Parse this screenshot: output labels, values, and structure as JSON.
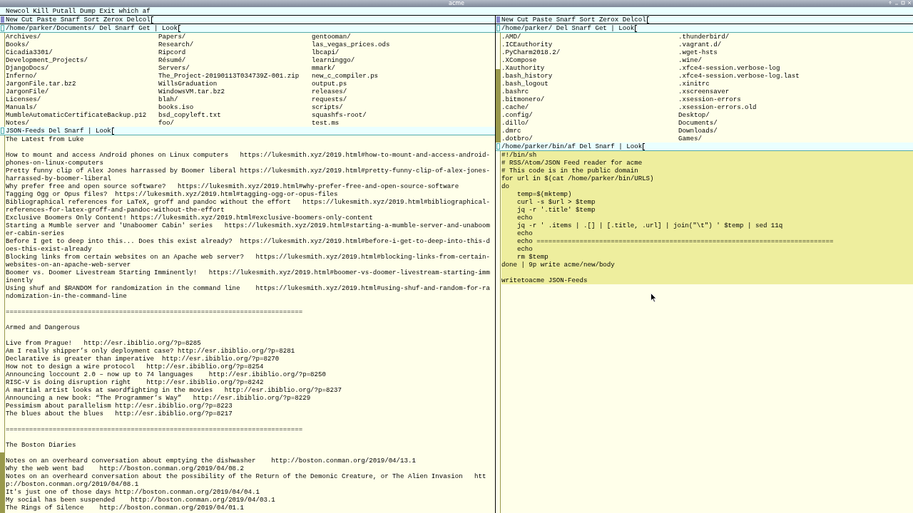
{
  "window": {
    "title": "acme"
  },
  "row_tag": "Newcol Kill Putall Dump Exit which af",
  "columns": [
    {
      "tag": "New Cut Paste Snarf Sort Zerox Delcol",
      "windows": [
        {
          "kind": "listing",
          "tag": "/home/parker/Documents/ Del Snarf Get | Look",
          "entries": [
            [
              "Archives/",
              "Books/",
              "Cicadia3301/",
              "Development_Projects/",
              "DjangoDocs/",
              "Inferno/",
              "JargonFile.tar.bz2",
              "JargonFile/",
              "Licenses/",
              "Manuals/",
              "MumbleAutomaticCertificateBackup.p12",
              "Notes/"
            ],
            [
              "Papers/",
              "Research/",
              "Ripcord",
              "Résumé/",
              "Servers/",
              "The_Project-20190113T034739Z-001.zip",
              "WillsGraduation",
              "WindowsVM.tar.bz2",
              "blah/",
              "books.iso",
              "bsd_copyleft.txt",
              "foo/"
            ],
            [
              "gentooman/",
              "las_vegas_prices.ods",
              "lbcapi/",
              "learninggo/",
              "mmark/",
              "new_c_compiler.ps",
              "output.ps",
              "releases/",
              "requests/",
              "scripts/",
              "squashfs-root/",
              "test.ms"
            ]
          ]
        },
        {
          "kind": "text",
          "tag": "JSON-Feeds Del Snarf | Look",
          "selected": false,
          "blocks": [
            [
              "The Latest from Luke"
            ],
            [
              "How to mount and access Android phones on Linux computers   https://lukesmith.xyz/2019.html#how-to-mount-and-access-android-phones-on-linux-computers",
              "Pretty funny clip of Alex Jones harrassed by Boomer liberal https://lukesmith.xyz/2019.html#pretty-funny-clip-of-alex-jones-harrassed-by-boomer-liberal",
              "Why prefer free and open source software?   https://lukesmith.xyz/2019.html#why-prefer-free-and-open-source-software",
              "Tagging Ogg or Opus files?  https://lukesmith.xyz/2019.html#tagging-ogg-or-opus-files",
              "Bibliographical references for LaTeX, groff and pandoc without the effort   https://lukesmith.xyz/2019.html#bibliographical-references-for-latex-groff-and-pandoc-without-the-effort",
              "Exclusive Boomers Only Content! https://lukesmith.xyz/2019.html#exclusive-boomers-only-content",
              "Starting a Mumble server and 'Unaboomer Cabin' series   https://lukesmith.xyz/2019.html#starting-a-mumble-server-and-unaboomer-cabin-series",
              "Before I get to deep into this... Does this exist already?  https://lukesmith.xyz/2019.html#before-i-get-to-deep-into-this-does-this-exist-already",
              "Blocking links from certain websites on an Apache web server?   https://lukesmith.xyz/2019.html#blocking-links-from-certain-websites-on-an-apache-web-server",
              "Boomer vs. Doomer Livestream Starting Imminently!   https://lukesmith.xyz/2019.html#boomer-vs-doomer-livestream-starting-imminently",
              "Using shuf and $RANDOM for randomization in the command line    https://lukesmith.xyz/2019.html#using-shuf-and-random-for-randomization-in-the-command-line"
            ],
            [
              "============================================================================"
            ],
            [
              "Armed and Dangerous"
            ],
            [
              "Live from Prague!   http://esr.ibiblio.org/?p=8285",
              "Am I really shipper’s only deployment case? http://esr.ibiblio.org/?p=8281",
              "Declarative is greater than imperative  http://esr.ibiblio.org/?p=8270",
              "How not to design a wire protocol   http://esr.ibiblio.org/?p=8254",
              "Announcing loccount 2.0 – now up to 74 languages    http://esr.ibiblio.org/?p=8250",
              "RISC-V is doing disruption right    http://esr.ibiblio.org/?p=8242",
              "A martial artist looks at swordfighting in the movies   http://esr.ibiblio.org/?p=8237",
              "Announcing a new book: “The Programmer’s Way”   http://esr.ibiblio.org/?p=8229",
              "Pessimism about parallelism http://esr.ibiblio.org/?p=8223",
              "The blues about the blues   http://esr.ibiblio.org/?p=8217"
            ],
            [
              "============================================================================"
            ],
            [
              "The Boston Diaries"
            ],
            [
              "Notes on an overheard conversation about emptying the dishwasher    http://boston.conman.org/2019/04/13.1",
              "Why the web went bad    http://boston.conman.org/2019/04/08.2",
              "Notes on an overheard conversation about the possibility of the Return of the Demonic Creature, or The Alien Invasion   http://boston.conman.org/2019/04/08.1",
              "It's just one of those days http://boston.conman.org/2019/04/04.1",
              "My social has been suspended    http://boston.conman.org/2019/04/03.1",
              "The Rings of Silence    http://boston.conman.org/2019/04/01.1"
            ]
          ]
        }
      ]
    },
    {
      "tag": "New Cut Paste Snarf Sort Zerox Delcol",
      "windows": [
        {
          "kind": "listing",
          "tag": "/home/parker/ Del Snarf Get | Look",
          "entries": [
            [
              ".AMD/",
              ".ICEauthority",
              ".PyCharm2018.2/",
              ".XCompose",
              ".Xauthority",
              ".bash_history",
              ".bash_logout",
              ".bashrc",
              ".bitmonero/",
              ".cache/",
              ".config/",
              ".dillo/",
              ".dmrc",
              ".dotbro/"
            ],
            [
              ".thunderbird/",
              ".vagrant.d/",
              ".wget-hsts",
              ".wine/",
              ".xfce4-session.verbose-log",
              ".xfce4-session.verbose-log.last",
              ".xinitrc",
              ".xscreensaver",
              ".xsession-errors",
              ".xsession-errors.old",
              "Desktop/",
              "Documents/",
              "Downloads/",
              "Games/"
            ]
          ]
        },
        {
          "kind": "text",
          "tag": "/home/parker/bin/af Del Snarf | Look",
          "selected": true,
          "blocks": [
            [
              "#!/bin/sh",
              "# RSS/Atom/JSON Feed reader for acme",
              "# This code is in the public domain",
              "for url in $(cat /home/parker/bin/URLS)",
              "do",
              "    temp=$(mktemp)",
              "    curl -s $url > $temp",
              "    jq -r '.title' $temp",
              "    echo",
              "    jq -r ' .items | .[] | [.title, .url] | join(\"\\t\") ' $temp | sed 11q",
              "    echo",
              "    echo ============================================================================",
              "    echo",
              "    rm $temp",
              "done | 9p write acme/new/body"
            ],
            [
              "writetoacme JSON-Feeds"
            ]
          ]
        }
      ]
    }
  ]
}
